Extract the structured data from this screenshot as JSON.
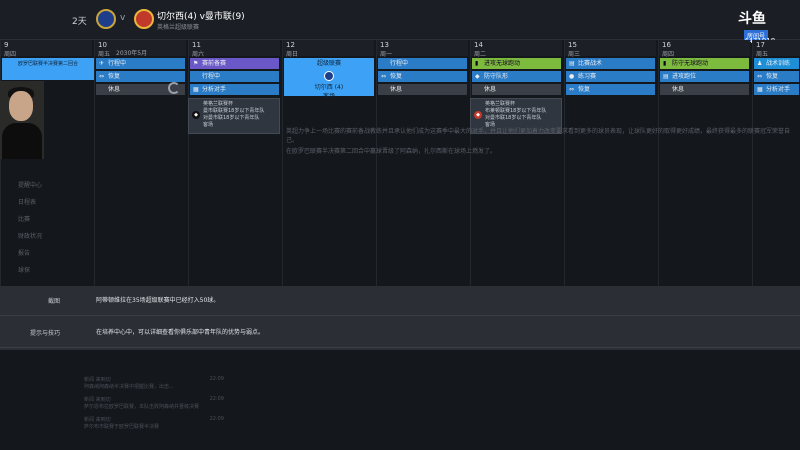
{
  "header": {
    "days": "2天",
    "vs": "v",
    "match_title": "切尔西(4) v曼市联(9)",
    "match_sub": "英格兰超级联赛",
    "stream_logo": "斗鱼",
    "stream_room_label": "房间号",
    "stream_room_num": "4471018"
  },
  "calendar": {
    "month_label": "2030年5月",
    "days": [
      {
        "num": "9",
        "week": "周四"
      },
      {
        "num": "10",
        "week": "周五"
      },
      {
        "num": "11",
        "week": "周六"
      },
      {
        "num": "12",
        "week": "周日"
      },
      {
        "num": "13",
        "week": "周一"
      },
      {
        "num": "14",
        "week": "周二"
      },
      {
        "num": "15",
        "week": "周三"
      },
      {
        "num": "16",
        "week": "周四"
      },
      {
        "num": "17",
        "week": "周五"
      }
    ],
    "first_card": "欧罗巴联赛半决赛第二回合",
    "day10": [
      "行程中",
      "恢复",
      "休息"
    ],
    "day11": [
      "赛前备赛",
      "行程中",
      "分析对手"
    ],
    "day12_card": {
      "title": "超级联赛",
      "team": "切尔西 (4)",
      "sub": "客场"
    },
    "day13": [
      "行程中",
      "恢复",
      "休息"
    ],
    "day14": [
      "进攻无球跑动",
      "防守队形",
      "休息"
    ],
    "day15": [
      "比赛战术",
      "练习赛",
      "恢复"
    ],
    "day16": [
      "防守无球跑动",
      "进攻跑位",
      "休息"
    ],
    "day17": [
      "战术训练",
      "恢复",
      "分析对手"
    ],
    "popup1": [
      "英格兰联赛杯",
      "曼市联联赛18岁以下青年队",
      "对曼市联18岁以下青年队",
      "客场"
    ],
    "popup2": [
      "英格兰联赛杯",
      "布莱顿联赛18岁以下青年队",
      "对曼市联18岁以下青年队",
      "客场"
    ]
  },
  "reminder": {
    "row1_label": "截图",
    "row1_text": "阿蒂顿维拉在35场超级联赛中已经打入50球。",
    "row2_label": "提示与技巧",
    "row2_text": "在培养中心中，可以详细查看你俱乐部中青年队的优势与弱点。"
  },
  "background": {
    "line1": "英超力争上一场比赛的赛前备战教练并且承认他们成为这赛季中最大的对手，并且让他们更加着力改变要求看到更多的球员表现，让球队更好的取得更好成绩，最终获得最多的联赛冠军荣誉自己。",
    "line2": "在欧罗巴联赛半决赛第二回合中赢球晋级了阿森纳，扎尔西斯在球场上燃发了。",
    "side_items": [
      "提醒中心",
      "日程表",
      "比赛",
      "财政状况",
      "报告",
      "球探"
    ],
    "news": [
      {
        "src": "新闻 来到切",
        "time": "22:09",
        "text": "阿森纳阿森纳半决赛中把握比赛，出击..."
      },
      {
        "src": "新闻 来到切",
        "time": "22:09",
        "text": "萨尔恩布拉欧罗巴联赛，本队击败阿森纳并晋级决赛"
      },
      {
        "src": "新闻 来到切",
        "time": "22:09",
        "text": "萨尔布市联赛于欧罗巴联赛半决赛"
      }
    ]
  },
  "colors": {
    "blue": "#2a7cc7",
    "gray": "#3a3f47",
    "purple": "#6a58c8",
    "green": "#7dbb3f",
    "match_card": "#3da2f5"
  }
}
